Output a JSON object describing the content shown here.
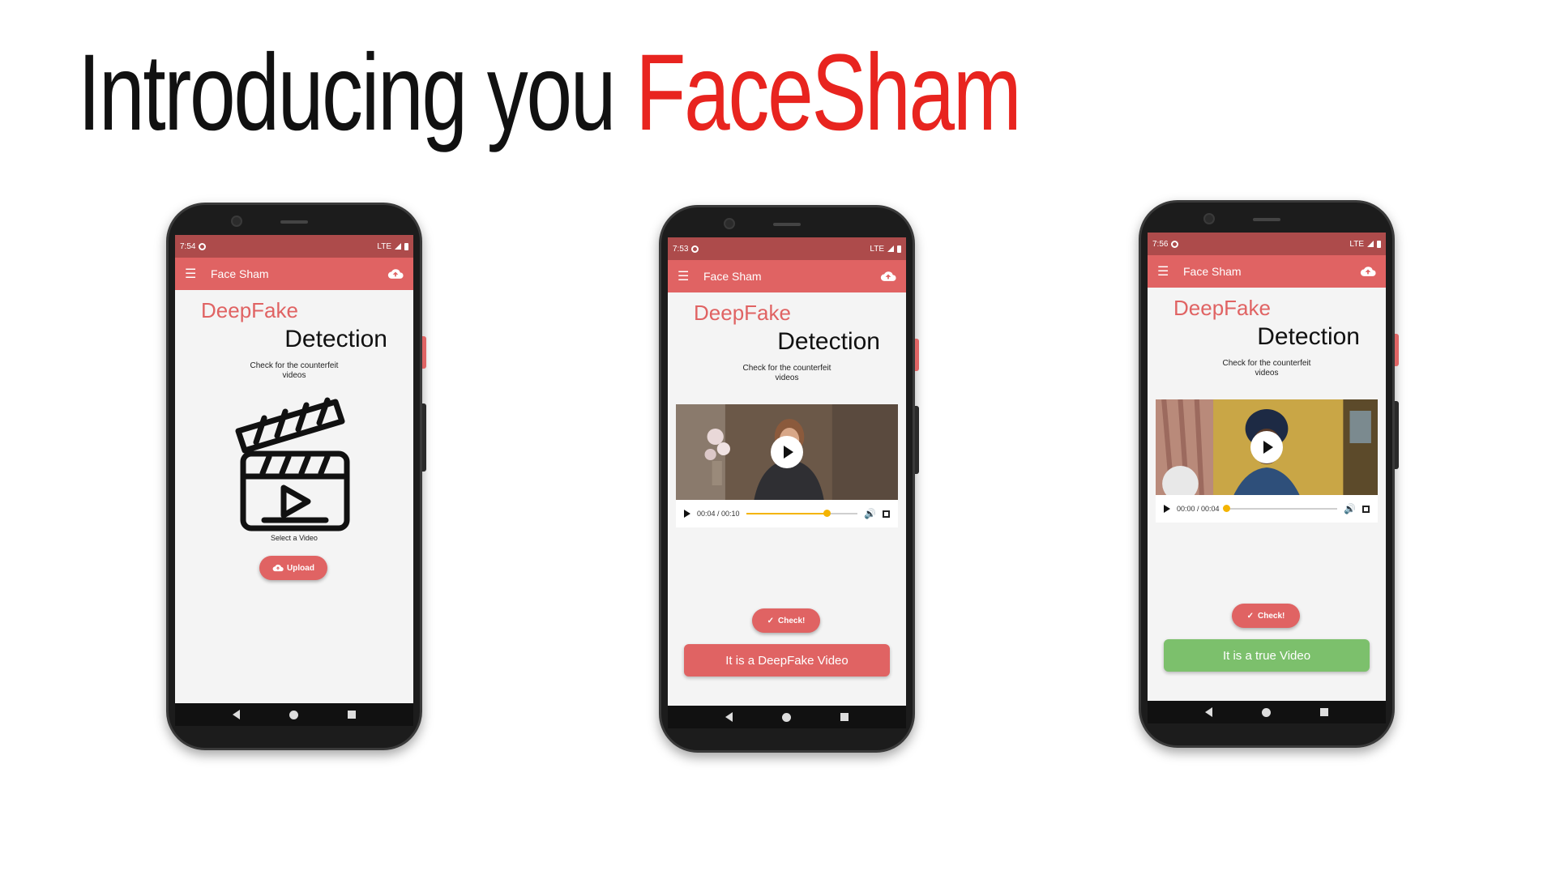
{
  "headline": {
    "prefix": "Introducing you",
    "brand": "FaceSham"
  },
  "colors": {
    "brand_red": "#e8241f",
    "app_accent": "#e06363",
    "status_bar": "#ad4b4b",
    "result_fake": "#e06363",
    "result_true": "#7cc06c",
    "slider": "#f4b400"
  },
  "app": {
    "title": "Face Sham",
    "heading_1": "DeepFake",
    "heading_2": "Detection",
    "subtitle_line1": "Check for the counterfeit",
    "subtitle_line2": "videos",
    "menu_icon": "hamburger-menu-icon",
    "upload_icon": "cloud-upload-icon"
  },
  "screens": [
    {
      "time": "7:54",
      "network": "LTE",
      "select_label": "Select a Video",
      "upload_label": "Upload"
    },
    {
      "time": "7:53",
      "network": "LTE",
      "video_time": "00:04 / 00:10",
      "progress": 0.72,
      "check_label": "Check!",
      "result": "It is a DeepFake Video"
    },
    {
      "time": "7:56",
      "network": "LTE",
      "video_time": "00:00 / 00:04",
      "progress": 0.0,
      "check_label": "Check!",
      "result": "It is a true Video"
    }
  ]
}
